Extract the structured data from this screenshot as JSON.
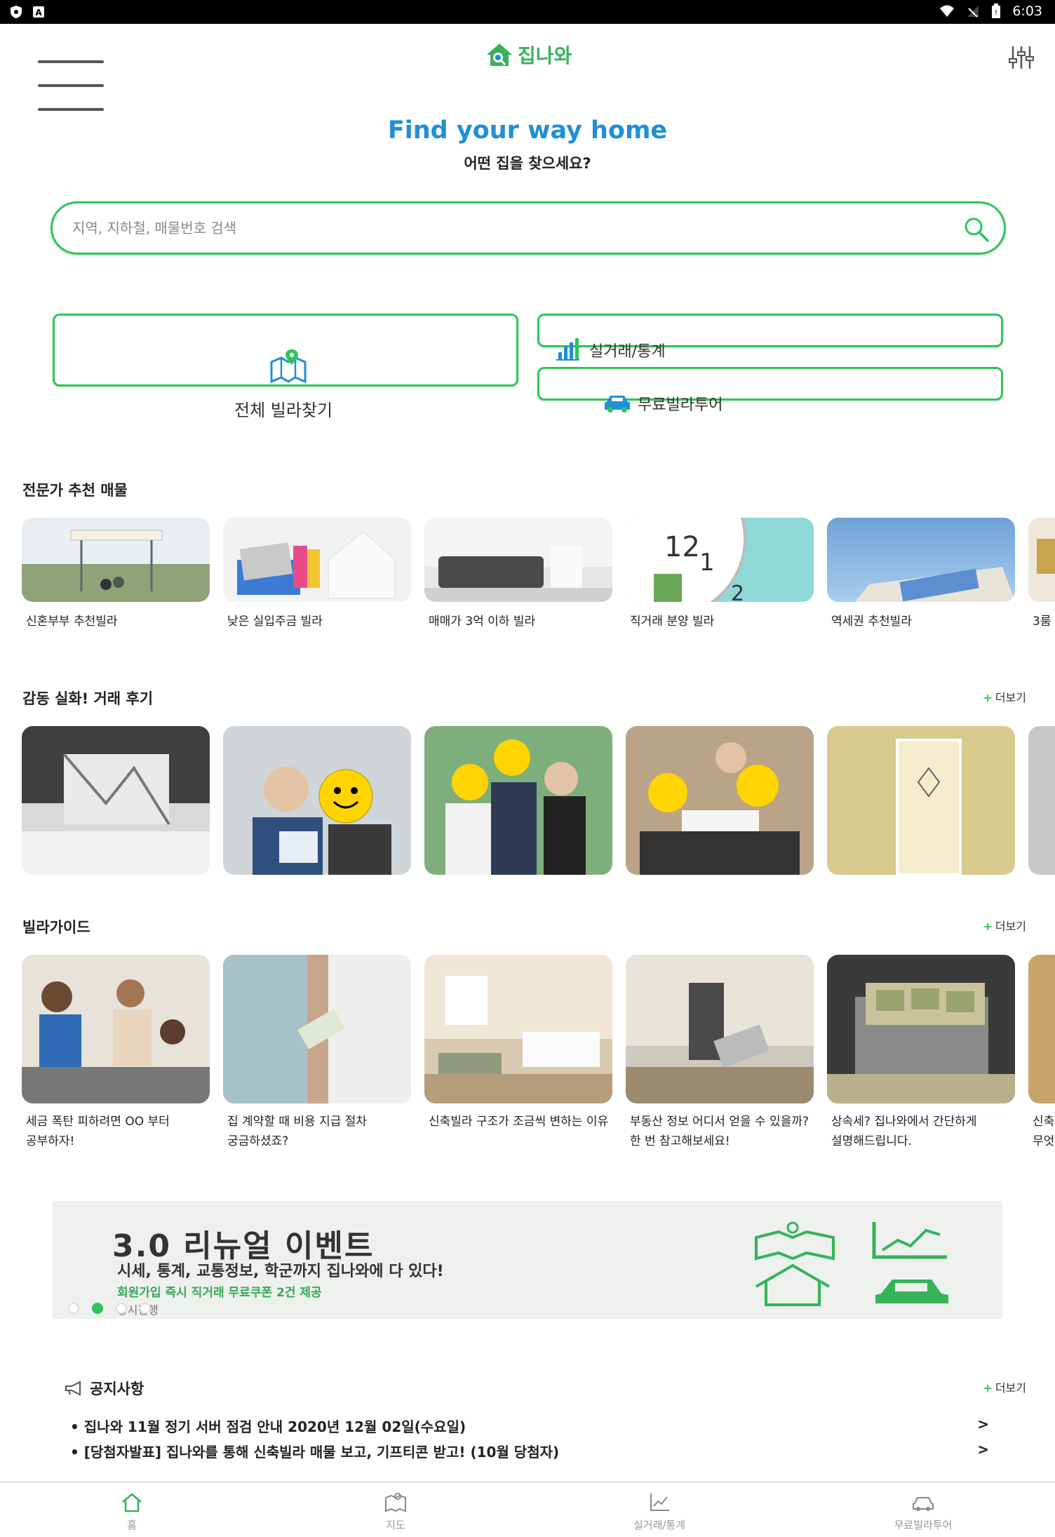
{
  "status_bar": {
    "time": "6:03"
  },
  "header": {
    "logo_text": "집나와"
  },
  "hero": {
    "tagline": "Find your way home",
    "subtitle": "어떤 집을 찾으세요?"
  },
  "search": {
    "placeholder": "지역, 지하철, 매물번호 검색",
    "value": ""
  },
  "quick_actions": {
    "all_villa": "전체 빌라찾기",
    "stats": "실거래/통계",
    "tour": "무료빌라투어"
  },
  "sections": {
    "recommended": {
      "title": "전문가 추천 매물",
      "items": [
        "신혼부부 추천빌라",
        "낮은 실입주금 빌라",
        "매매가 3억 이하 빌라",
        "직거래 분양 빌라",
        "역세권 추천빌라",
        "3룸"
      ]
    },
    "reviews": {
      "title": "감동 실화! 거래 후기",
      "more": "더보기"
    },
    "guide": {
      "title": "빌라가이드",
      "more": "더보기",
      "items": [
        [
          "세금 폭탄 피하려면 OO 부터",
          "공부하자!"
        ],
        [
          "집 계약할 때 비용 지급 절차",
          "궁금하셨죠?"
        ],
        [
          "신축빌라 구조가 조금씩 변하는 이유",
          ""
        ],
        [
          "부동산 정보 어디서 얻을 수 있을까?",
          "한 번 참고해보세요!"
        ],
        [
          "상속세? 집나와에서 간단하게",
          "설명해드립니다."
        ],
        [
          "신축",
          "무엇"
        ]
      ]
    }
  },
  "banner": {
    "headline": "3.0 리뉴얼 이벤트",
    "line2": "시세, 통계, 교통정보, 학군까지 집나와에 다 있다!",
    "line3": "회원가입 즉시 직거래 무료쿠폰 2건 제공",
    "line4": "상시진행",
    "active_slide": 2,
    "slide_count": 4
  },
  "notice": {
    "title": "공지사항",
    "more": "더보기",
    "items": [
      "집나와 11월 정기 서버 점검 안내 2020년 12월 02일(수요일)",
      "[당첨자발표] 집나와를 통해 신축빌라 매물 보고, 기프티콘 받고! (10월 당첨자)"
    ],
    "arrow": ">"
  },
  "bullet": "•",
  "more_prefix": "+",
  "tabbar": {
    "home": "홈",
    "map": "지도",
    "stats": "실거래/통계",
    "tour": "무료빌라투어"
  },
  "colors": {
    "accent": "#2fc45a",
    "tagline": "#1f8fd6"
  }
}
